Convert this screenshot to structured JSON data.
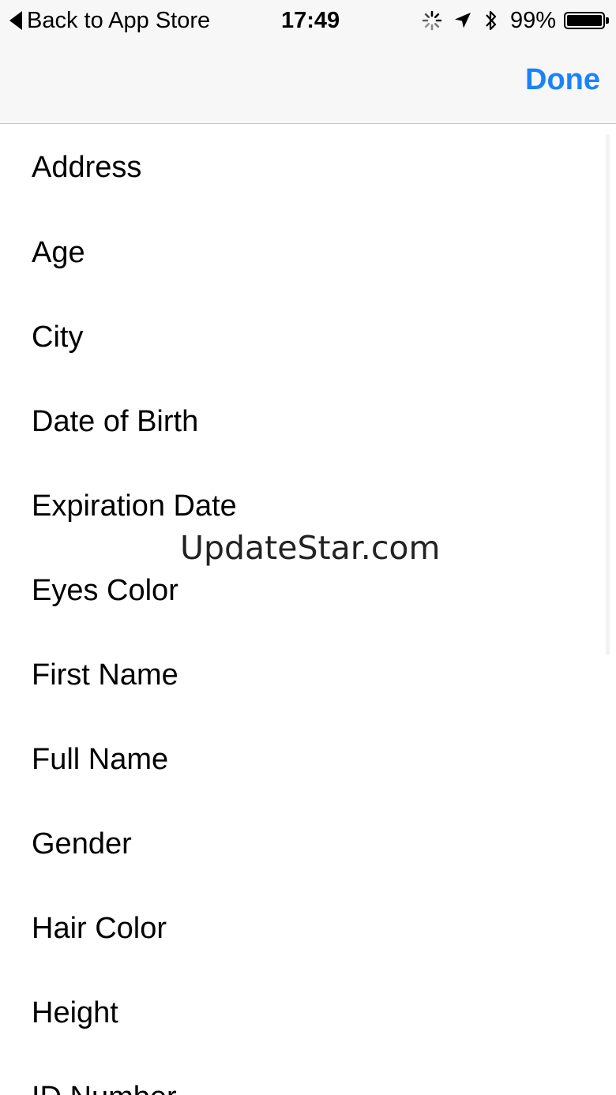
{
  "status_bar": {
    "back_label": "Back to App Store",
    "time": "17:49",
    "battery_percent": "99%",
    "battery_level": 0.99,
    "icons": [
      "activity-spinner-icon",
      "location-arrow-icon",
      "bluetooth-icon",
      "battery-icon"
    ]
  },
  "navbar": {
    "done_label": "Done"
  },
  "colors": {
    "accent": "#1a82fb",
    "bar_background": "#f7f7f7",
    "separator": "#c8c7cc"
  },
  "fields": [
    "Address",
    "Age",
    "City",
    "Date of Birth",
    "Expiration Date",
    "Eyes Color",
    "First Name",
    "Full Name",
    "Gender",
    "Hair Color",
    "Height",
    "ID Number"
  ],
  "watermark": "UpdateStar.com"
}
